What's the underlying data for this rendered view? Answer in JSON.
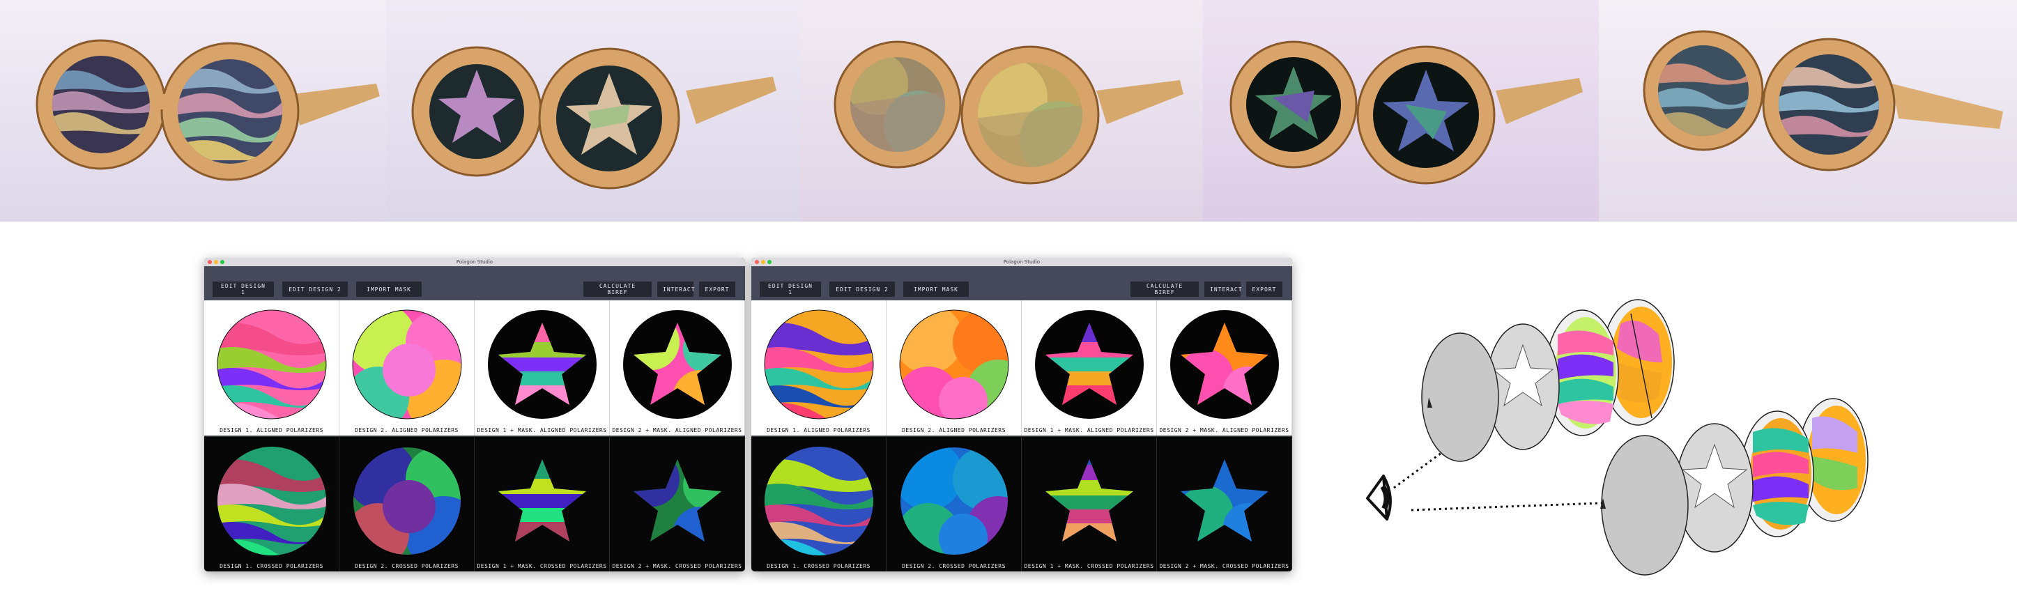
{
  "window": {
    "title": "Polagon Studio",
    "buttons": {
      "edit1": "EDIT DESIGN 1",
      "edit2": "EDIT DESIGN 2",
      "import": "IMPORT MASK",
      "calculate": "CALCULATE BIREF",
      "interact": "INTERACT",
      "export": "EXPORT"
    }
  },
  "captions": {
    "d1_aligned": "DESIGN 1. ALIGNED POLARIZERS",
    "d2_aligned": "DESIGN 2. ALIGNED POLARIZERS",
    "d1_mask_aligned": "DESIGN 1 + MASK. ALIGNED POLARIZERS",
    "d2_mask_aligned": "DESIGN 2 + MASK. ALIGNED POLARIZERS",
    "d1_crossed": "DESIGN 1. CROSSED POLARIZERS",
    "d2_crossed": "DESIGN 2. CROSSED POLARIZERS",
    "d1_mask_crossed": "DESIGN 1 + MASK. CROSSED POLARIZERS",
    "d2_mask_crossed": "DESIGN 2 + MASK. CROSSED POLARIZERS"
  },
  "colors": {
    "toolbar_bg": "#45495a",
    "button_bg": "#252833",
    "titlebar": "#dcdce0",
    "traffic_red": "#ff5f57",
    "traffic_yellow": "#febc2e",
    "traffic_green": "#28c840",
    "wood": "#d9a86a"
  },
  "icons": {
    "eye": "eye-icon"
  }
}
